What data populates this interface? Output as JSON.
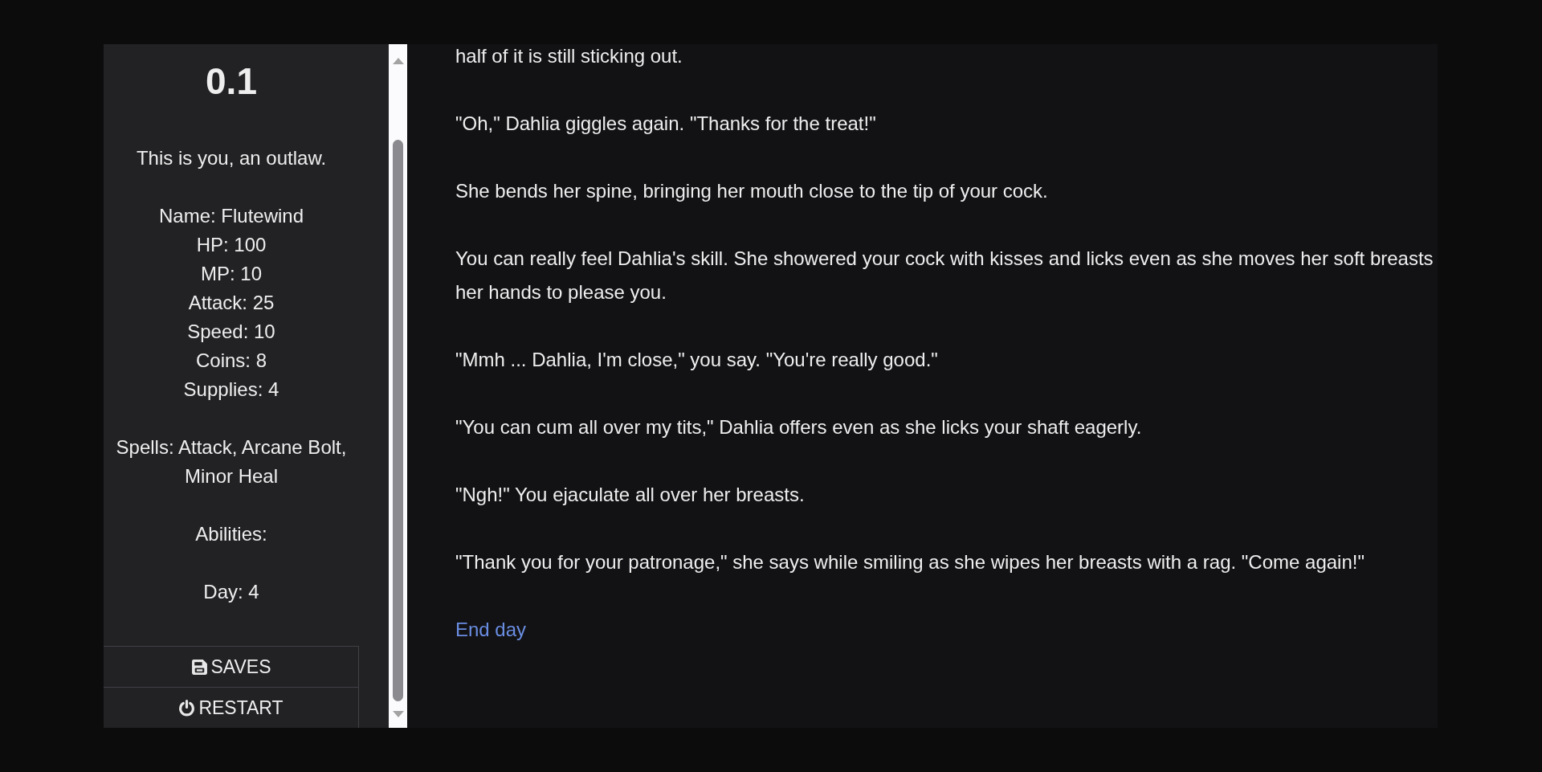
{
  "sidebar": {
    "version": "0.1",
    "intro": "This is you, an outlaw.",
    "stats": [
      "Name: Flutewind",
      "HP: 100",
      "MP: 10",
      "Attack: 25",
      "Speed: 10",
      "Coins: 8",
      "Supplies: 4"
    ],
    "spells": "Spells: Attack, Arcane Bolt, Minor Heal",
    "abilities": "Abilities:",
    "day": "Day: 4",
    "menu": [
      {
        "kind": "saves",
        "label": "SAVES"
      },
      {
        "kind": "restart",
        "label": "RESTART"
      }
    ]
  },
  "passage": {
    "paragraphs": [
      "half of it is still sticking out.",
      "\"Oh,\" Dahlia giggles again. \"Thanks for the treat!\"",
      "She bends her spine, bringing her mouth close to the tip of your cock.",
      "You can really feel Dahlia's skill. She showered your cock with kisses and licks even as she moves her soft breasts her hands to please you.",
      "\"Mmh ... Dahlia, I'm close,\" you say. \"You're really good.\"",
      "\"You can cum all over my tits,\" Dahlia offers even as she licks your shaft eagerly.",
      "\"Ngh!\" You ejaculate all over her breasts.",
      "\"Thank you for your patronage,\" she says while smiling as she wipes her breasts with a rag. \"Come again!\""
    ],
    "link": "End day"
  }
}
